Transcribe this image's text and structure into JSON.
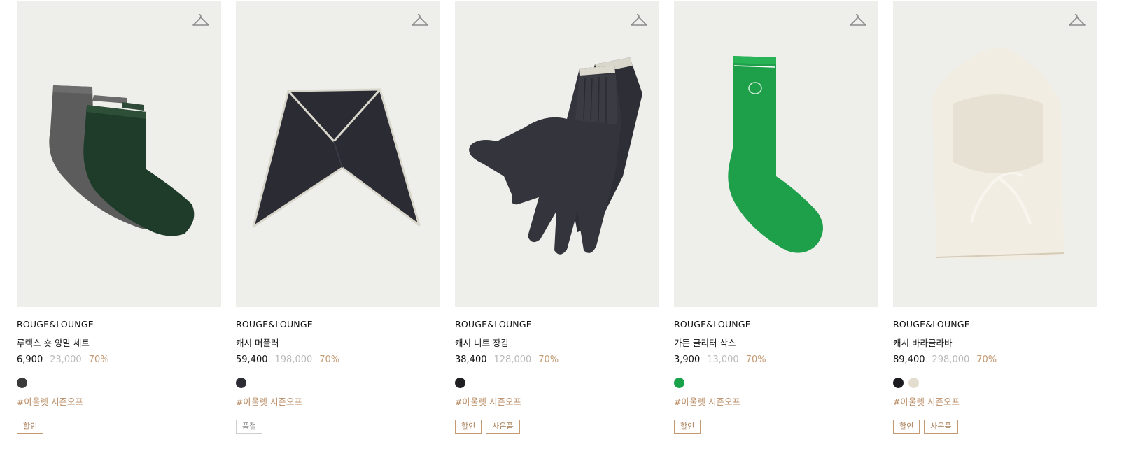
{
  "products": [
    {
      "brand": "ROUGE&LOUNGE",
      "name": "루렉스 숏 양말 세트",
      "price": "6,900",
      "original_price": "23,000",
      "discount": "70%",
      "swatches": [
        "#3a3a3a"
      ],
      "hashtag": "#아울렛 시즌오프",
      "badges": [
        {
          "label": "할인",
          "type": "sale"
        }
      ],
      "image_icon": "socks-set-image"
    },
    {
      "brand": "ROUGE&LOUNGE",
      "name": "캐시 머플러",
      "price": "59,400",
      "original_price": "198,000",
      "discount": "70%",
      "swatches": [
        "#2c2c34"
      ],
      "hashtag": "#아울렛 시즌오프",
      "badges": [
        {
          "label": "품절",
          "type": "soldout"
        }
      ],
      "image_icon": "muffler-image"
    },
    {
      "brand": "ROUGE&LOUNGE",
      "name": "캐시 니트 장갑",
      "price": "38,400",
      "original_price": "128,000",
      "discount": "70%",
      "swatches": [
        "#1f1f22"
      ],
      "hashtag": "#아울렛 시즌오프",
      "badges": [
        {
          "label": "할인",
          "type": "sale"
        },
        {
          "label": "사은품",
          "type": "gift"
        }
      ],
      "image_icon": "gloves-image"
    },
    {
      "brand": "ROUGE&LOUNGE",
      "name": "가든 글리터 삭스",
      "price": "3,900",
      "original_price": "13,000",
      "discount": "70%",
      "swatches": [
        "#1aa24a"
      ],
      "hashtag": "#아울렛 시즌오프",
      "badges": [
        {
          "label": "할인",
          "type": "sale"
        }
      ],
      "image_icon": "green-sock-image"
    },
    {
      "brand": "ROUGE&LOUNGE",
      "name": "캐시 바라클라바",
      "price": "89,400",
      "original_price": "298,000",
      "discount": "70%",
      "swatches": [
        "#1c1c20",
        "#e3ddd0"
      ],
      "hashtag": "#아울렛 시즌오프",
      "badges": [
        {
          "label": "할인",
          "type": "sale"
        },
        {
          "label": "사은품",
          "type": "gift"
        }
      ],
      "image_icon": "balaclava-image"
    }
  ],
  "colors": {
    "image_bg": "#eeeeea",
    "accent": "#c49a73",
    "hashtag": "#b88a62",
    "muted_price": "#b9b9b9"
  },
  "icons": {
    "hanger": "hanger-icon"
  }
}
